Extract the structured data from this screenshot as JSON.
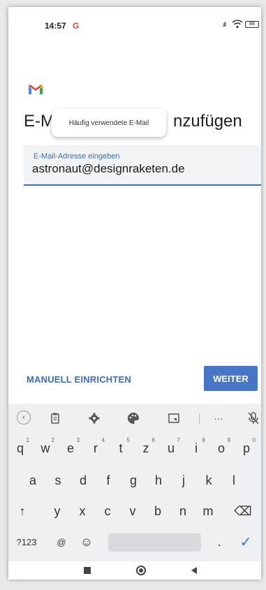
{
  "status_bar": {
    "time": "14:57",
    "app_indicator": "G",
    "signal": ".ıll",
    "wifi_icon": "wifi-icon",
    "battery": "88"
  },
  "header": {
    "logo": "gmail-logo",
    "title_prefix": "E-M",
    "title_suffix": "nzufügen"
  },
  "tooltip": {
    "text": "Häufig verwendete E-Mail"
  },
  "email_field": {
    "label": "E-Mail-Adresse eingeben",
    "value": "astronaut@designraketen.de"
  },
  "actions": {
    "manual_label": "MANUELL EINRICHTEN",
    "next_label": "WEITER"
  },
  "keyboard": {
    "toolbar": [
      "back-icon",
      "clipboard-icon",
      "gear-icon",
      "palette-icon",
      "resize-icon",
      "more-icon",
      "mic-off-icon"
    ],
    "more_label": "···",
    "row1": [
      {
        "char": "q",
        "hint": "1"
      },
      {
        "char": "w",
        "hint": "2"
      },
      {
        "char": "e",
        "hint": "3"
      },
      {
        "char": "r",
        "hint": "4"
      },
      {
        "char": "t",
        "hint": "5"
      },
      {
        "char": "z",
        "hint": "6"
      },
      {
        "char": "u",
        "hint": "7"
      },
      {
        "char": "i",
        "hint": "8"
      },
      {
        "char": "o",
        "hint": "9"
      },
      {
        "char": "p",
        "hint": "0"
      }
    ],
    "row2": [
      "a",
      "s",
      "d",
      "f",
      "g",
      "h",
      "j",
      "k",
      "l"
    ],
    "row3": [
      "y",
      "x",
      "c",
      "v",
      "b",
      "n",
      "m"
    ],
    "shift_symbol": "↑",
    "backspace_symbol": "⌫",
    "symbols_label": "?123",
    "at_label": "@",
    "emoji_symbol": "☺",
    "period_label": ".",
    "enter_symbol": "✓"
  },
  "colors": {
    "accent": "#3a6fc4",
    "button_bg": "#4776c6",
    "gmail_red": "#e8453c"
  }
}
